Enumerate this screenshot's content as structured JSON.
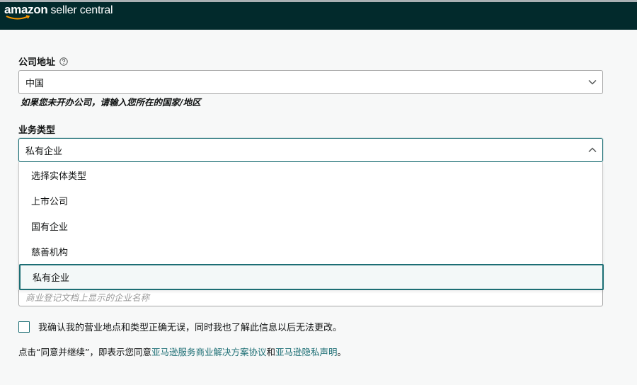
{
  "header": {
    "logo_brand": "amazon",
    "logo_product": "seller central"
  },
  "company_address": {
    "label": "公司地址",
    "value": "中国",
    "hint": "如果您未开办公司，请输入您所在的国家/地区"
  },
  "business_type": {
    "label": "业务类型",
    "value": "私有企业",
    "options": [
      {
        "label": "选择实体类型"
      },
      {
        "label": "上市公司"
      },
      {
        "label": "国有企业"
      },
      {
        "label": "慈善机构"
      },
      {
        "label": "私有企业"
      }
    ],
    "selected_index": 4
  },
  "business_name": {
    "placeholder": "商业登记文档上显示的企业名称"
  },
  "confirm": {
    "label": "我确认我的营业地点和类型正确无误，同时我也了解此信息以后无法更改。",
    "checked": false
  },
  "agreement": {
    "prefix": "点击“同意并继续”，即表示您同意",
    "link1": "亚马逊服务商业解决方案协议",
    "middle": "和",
    "link2": "亚马逊隐私声明",
    "suffix": "。"
  },
  "colors": {
    "header_bg": "#022a2c",
    "accent": "#1c6e74",
    "page_bg": "#f7f8f8"
  }
}
